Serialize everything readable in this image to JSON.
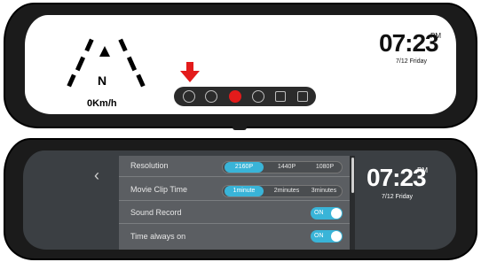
{
  "home": {
    "speed": "0Km/h",
    "compass_letter": "N",
    "time": "07:23",
    "ampm": "PM",
    "date": "7/12 Friday",
    "toolbar_icons": [
      "settings-icon",
      "playback-icon",
      "record-icon",
      "mode-icon",
      "camera-icon",
      "lock-icon"
    ],
    "arrow_color": "#e31b1b"
  },
  "settings": {
    "back_label": "‹",
    "rows": [
      {
        "label": "Resolution",
        "type": "segmented",
        "options": [
          "2160P",
          "1440P",
          "1080P"
        ],
        "selected": "2160P"
      },
      {
        "label": "Movie Clip Time",
        "type": "segmented",
        "options": [
          "1minute",
          "2minutes",
          "3minutes"
        ],
        "selected": "1minute"
      },
      {
        "label": "Sound Record",
        "type": "toggle",
        "value": "ON"
      },
      {
        "label": "Time always on",
        "type": "toggle",
        "value": "ON"
      }
    ],
    "time": "07:23",
    "ampm": "PM",
    "date": "7/12 Friday",
    "accent_color": "#39b4d8"
  }
}
